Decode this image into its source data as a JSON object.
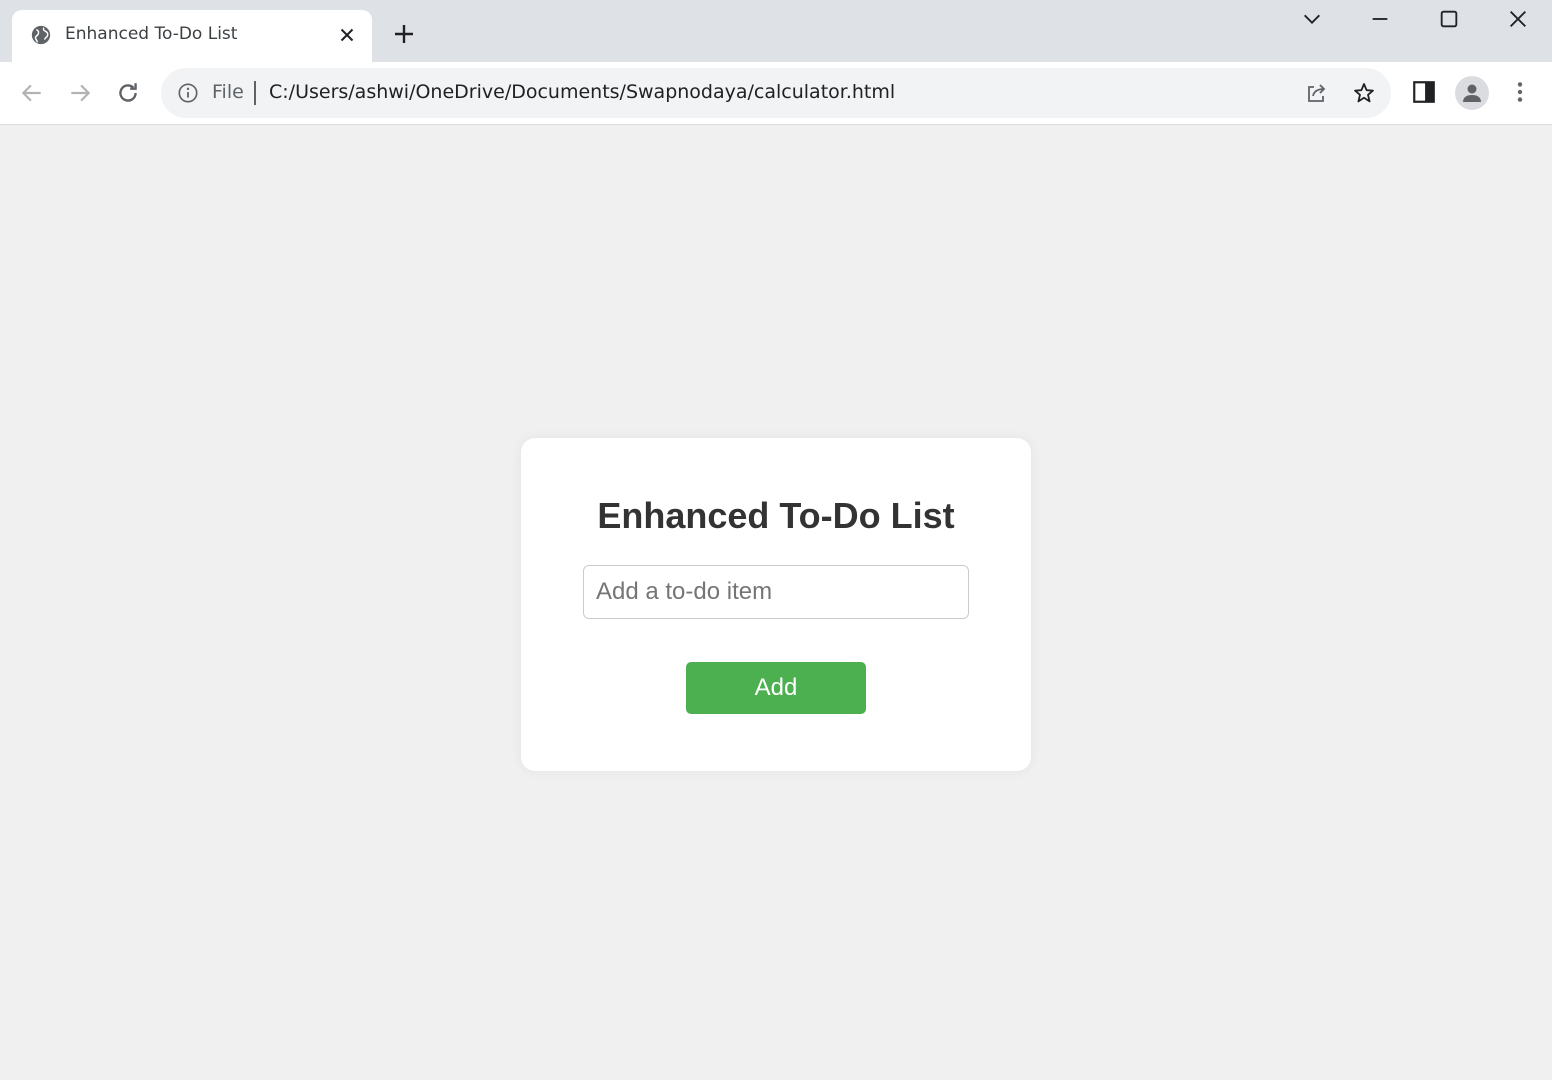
{
  "browser": {
    "tab_title": "Enhanced To-Do List",
    "address": {
      "scheme_label": "File",
      "url": "C:/Users/ashwi/OneDrive/Documents/Swapnodaya/calculator.html"
    },
    "icons": {
      "favicon": "globe-icon",
      "tab_close": "close-icon",
      "new_tab": "plus-icon",
      "tab_search": "chevron-down-icon",
      "minimize": "minimize-icon",
      "maximize": "maximize-icon",
      "window_close": "close-icon",
      "back": "arrow-left-icon",
      "forward": "arrow-right-icon",
      "reload": "reload-icon",
      "site_info": "info-icon",
      "share": "share-icon",
      "bookmark": "star-icon",
      "side_panel": "side-panel-icon",
      "profile": "profile-icon",
      "menu": "kebab-menu-icon"
    }
  },
  "app": {
    "title": "Enhanced To-Do List",
    "input": {
      "placeholder": "Add a to-do item",
      "value": ""
    },
    "add_button_label": "Add",
    "items": []
  },
  "colors": {
    "page_background": "#f0f0f0",
    "card_background": "#ffffff",
    "add_button": "#4caf50",
    "title_text": "#333333"
  }
}
